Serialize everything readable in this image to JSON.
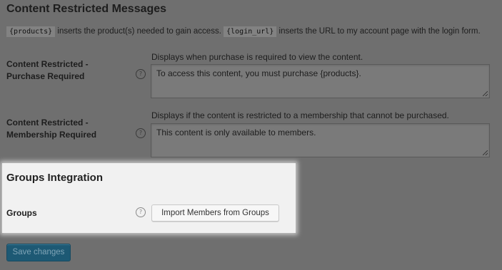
{
  "content_restricted": {
    "title": "Content Restricted Messages",
    "intro": {
      "code_products": "{products}",
      "text_products": " inserts the product(s) needed to gain access. ",
      "code_login": "{login_url}",
      "text_login": " inserts the URL to my account page with the login form."
    },
    "purchase_required": {
      "label": "Content Restricted - Purchase Required",
      "help_icon": "?",
      "description": "Displays when purchase is required to view the content.",
      "value": "To access this content, you must purchase {products}."
    },
    "membership_required": {
      "label": "Content Restricted - Membership Required",
      "help_icon": "?",
      "description": "Displays if the content is restricted to a membership that cannot be purchased.",
      "value": "This content is only available to members."
    }
  },
  "groups_integration": {
    "title": "Groups Integration",
    "groups_label": "Groups",
    "help_icon": "?",
    "import_button_label": "Import Members from Groups"
  },
  "footer": {
    "save_label": "Save changes"
  },
  "colors": {
    "overlay_background": "#6f6f6f",
    "highlight_background": "#f1f1f1",
    "primary_button": "#1d5974"
  },
  "icons": {
    "help": "question-circle-icon",
    "resize": "resize-grip-icon"
  }
}
